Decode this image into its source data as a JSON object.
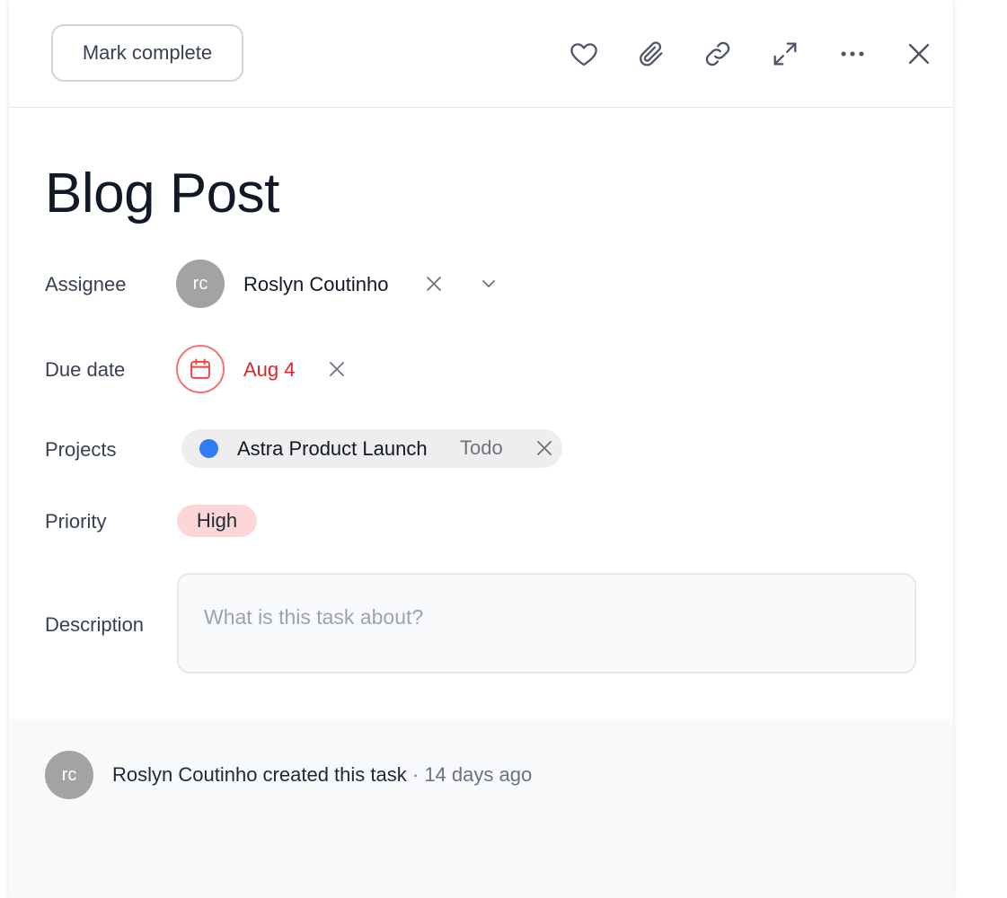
{
  "toolbar": {
    "mark_complete_label": "Mark complete",
    "icons": [
      "heart-icon",
      "paperclip-icon",
      "link-icon",
      "expand-icon",
      "more-icon",
      "close-icon"
    ]
  },
  "task": {
    "title": "Blog Post",
    "assignee": {
      "label": "Assignee",
      "initials": "rc",
      "name": "Roslyn Coutinho"
    },
    "due_date": {
      "label": "Due date",
      "value": "Aug 4",
      "color": "#dc2626"
    },
    "projects": {
      "label": "Projects",
      "name": "Astra Product Launch",
      "status": "Todo",
      "dot_color": "#2f7cf6"
    },
    "priority": {
      "label": "Priority",
      "value": "High",
      "color": "#fdd7d7"
    },
    "description": {
      "label": "Description",
      "value": "",
      "placeholder": "What is this task about?"
    }
  },
  "activity": {
    "initials": "rc",
    "actor": "Roslyn Coutinho",
    "action": " created this task",
    "separator": " · ",
    "time": "14 days ago"
  }
}
